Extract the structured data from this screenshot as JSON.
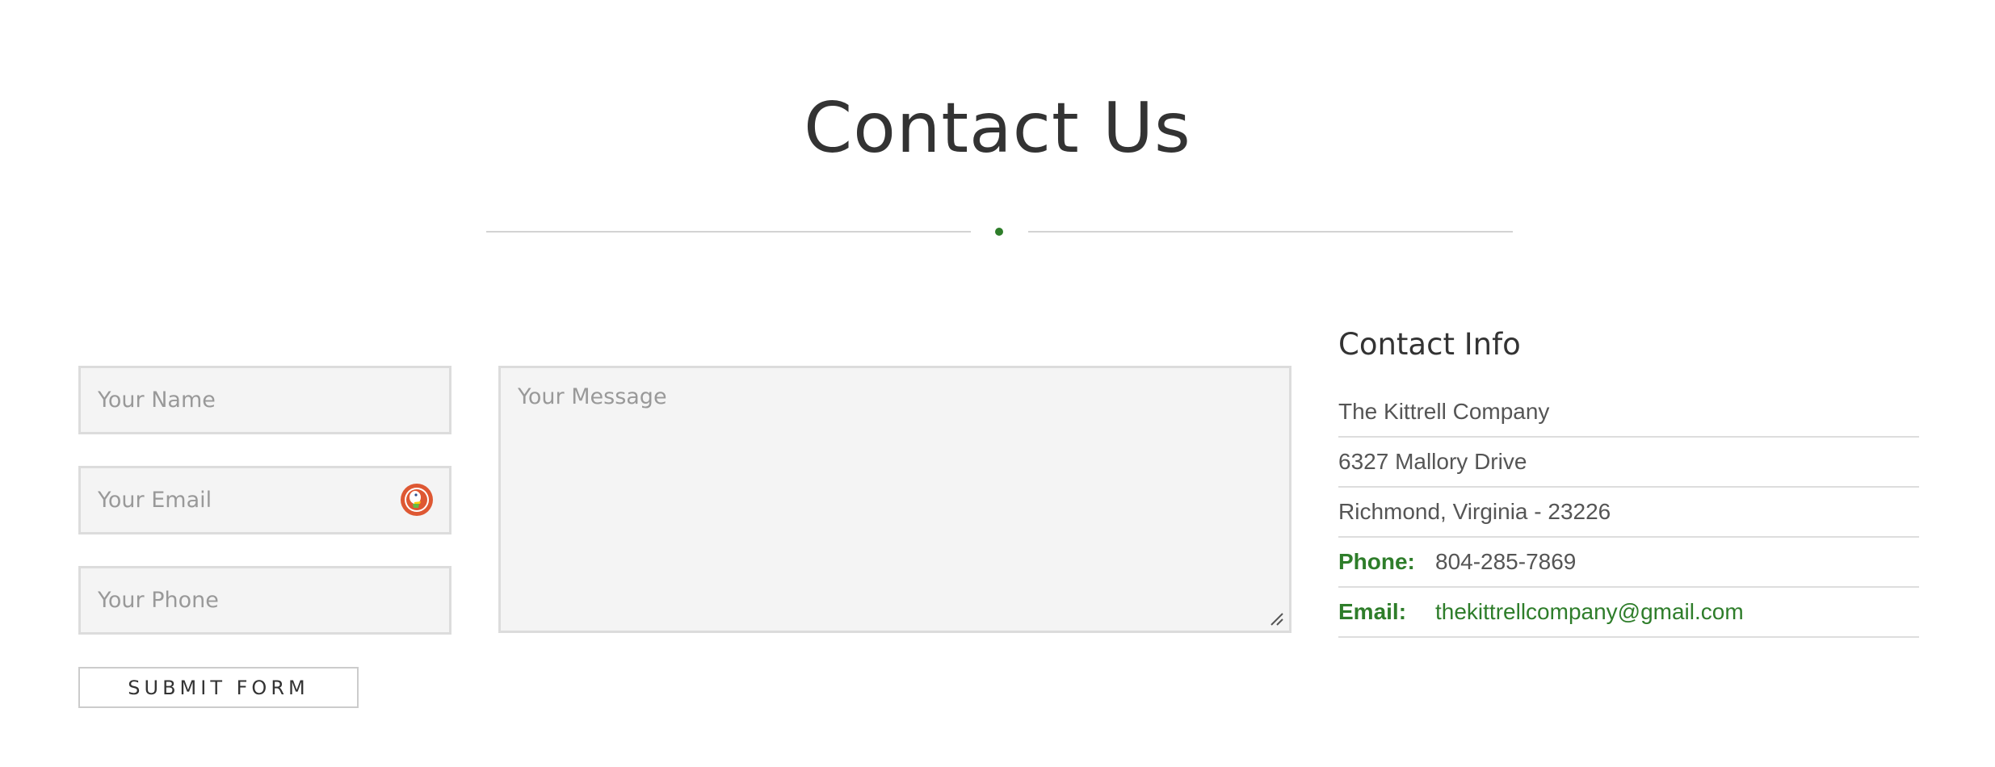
{
  "header": {
    "title": "Contact Us"
  },
  "form": {
    "name_placeholder": "Your Name",
    "email_placeholder": "Your Email",
    "phone_placeholder": "Your Phone",
    "message_placeholder": "Your Message",
    "submit_label": "SUBMIT FORM"
  },
  "contact_info": {
    "heading": "Contact Info",
    "company": "The Kittrell Company",
    "address_line1": "6327 Mallory Drive",
    "address_line2": "Richmond, Virginia - 23226",
    "phone_label": "Phone:",
    "phone_value": "804-285-7869",
    "email_label": "Email:",
    "email_value": "thekittrellcompany@gmail.com"
  },
  "colors": {
    "accent": "#2e7d2a",
    "field_bg": "#f4f4f4",
    "text": "#333333"
  },
  "icons": {
    "email_field_icon": "duckduckgo-icon"
  }
}
